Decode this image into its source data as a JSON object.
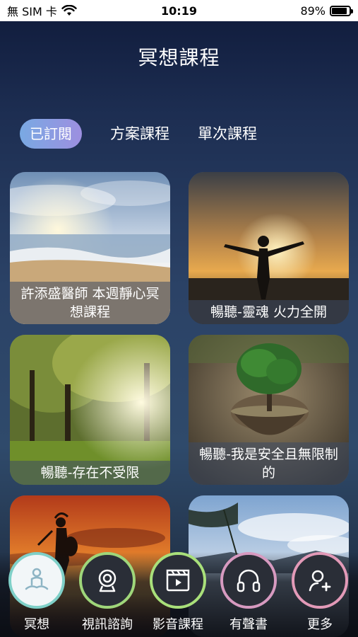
{
  "status": {
    "carrier": "無 SIM 卡",
    "time": "10:19",
    "battery": "89%",
    "battery_level": 0.89
  },
  "page": {
    "title": "冥想課程"
  },
  "tabs": [
    {
      "label": "已訂閱",
      "active": true
    },
    {
      "label": "方案課程",
      "active": false
    },
    {
      "label": "單次課程",
      "active": false
    }
  ],
  "cards": [
    {
      "label": "許添盛醫師 本週靜心冥想課程",
      "image": "beach-sunrise"
    },
    {
      "label": "暢聽-靈魂 火力全開",
      "image": "person-sunset"
    },
    {
      "label": "暢聽-存在不受限",
      "image": "forest-sunlight"
    },
    {
      "label": "暢聽-我是安全且無限制的",
      "image": "tree-sphere"
    },
    {
      "label": "",
      "image": "warrior-sunset"
    },
    {
      "label": "",
      "image": "lake-clouds"
    }
  ],
  "nav": [
    {
      "label": "冥想",
      "icon": "meditation-icon",
      "ring": "#7fd0c8",
      "active": true
    },
    {
      "label": "視訊諮詢",
      "icon": "webcam-icon",
      "ring": "#9fd67a",
      "active": false
    },
    {
      "label": "影音課程",
      "icon": "film-clapper-icon",
      "ring": "#a9e07a",
      "active": false
    },
    {
      "label": "有聲書",
      "icon": "headphones-icon",
      "ring": "#d79ac0",
      "active": false
    },
    {
      "label": "更多",
      "icon": "add-user-icon",
      "ring": "#e39ab8",
      "active": false
    }
  ]
}
